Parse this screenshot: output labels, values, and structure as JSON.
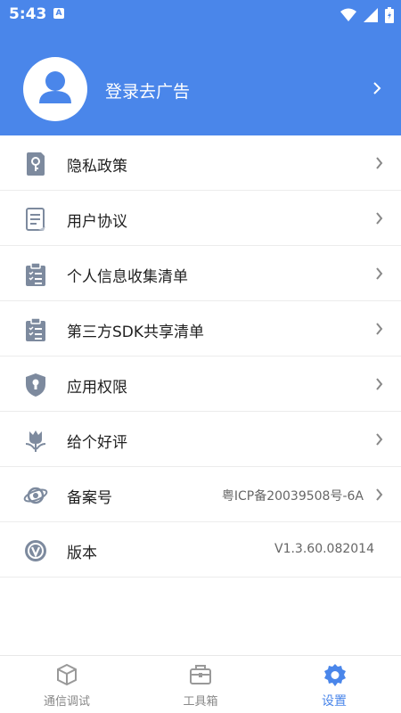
{
  "status_bar": {
    "time": "5:43",
    "indicator": "A"
  },
  "header": {
    "login_label": "登录去广告"
  },
  "menu": {
    "items": [
      {
        "label": "隐私政策",
        "icon": "key-document-icon"
      },
      {
        "label": "用户协议",
        "icon": "document-icon"
      },
      {
        "label": "个人信息收集清单",
        "icon": "clipboard-list-icon"
      },
      {
        "label": "第三方SDK共享清单",
        "icon": "clipboard-list-icon"
      },
      {
        "label": "应用权限",
        "icon": "shield-lock-icon"
      },
      {
        "label": "给个好评",
        "icon": "flower-icon"
      },
      {
        "label": "备案号",
        "value": "粤ICP备20039508号-6A",
        "icon": "planet-icon"
      },
      {
        "label": "版本",
        "value": "V1.3.60.082014",
        "icon": "version-icon"
      }
    ]
  },
  "tabbar": {
    "tabs": [
      {
        "label": "通信调试",
        "icon": "cube-icon",
        "active": false
      },
      {
        "label": "工具箱",
        "icon": "toolbox-icon",
        "active": false
      },
      {
        "label": "设置",
        "icon": "gear-icon",
        "active": true
      }
    ]
  },
  "colors": {
    "accent": "#4a86ea",
    "icon_gray": "#7d8a9e"
  }
}
